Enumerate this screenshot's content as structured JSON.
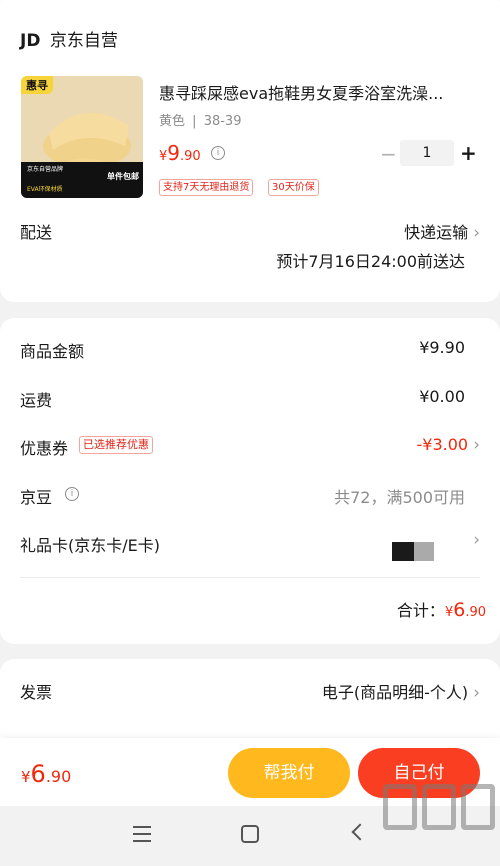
{
  "store": {
    "logo": "JD",
    "name": "京东自营"
  },
  "product": {
    "brand_badge": "惠寻",
    "title": "惠寻踩屎感eva拖鞋男女夏季浴室洗澡...",
    "spec_color": "黄色",
    "spec_divider": "|",
    "spec_size": "38-39",
    "price_symbol": "¥",
    "price_int": "9",
    "price_dec": ".90",
    "tags": [
      "支持7天无理由退货",
      "30天价保"
    ],
    "thumb_text": [
      "京东自营品牌",
      "单件包邮",
      "EVA环保材质"
    ],
    "thumb_colors": {
      "background": "#ead9b2",
      "slipper": "#f0d28a",
      "badge": "#f7d43a",
      "strip": "#111111"
    }
  },
  "stepper": {
    "minus": "−",
    "quantity": "1",
    "plus": "+"
  },
  "delivery": {
    "label": "配送",
    "method": "快递运输",
    "estimate": "预计7月16日24:00前送达"
  },
  "summary": {
    "goods_label": "商品金额",
    "goods_value": "¥9.90",
    "shipping_label": "运费",
    "shipping_value": "¥0.00",
    "coupon_label": "优惠券",
    "coupon_tag": "已选推荐优惠",
    "coupon_value": "-¥3.00",
    "beans_label": "京豆",
    "beans_value": "共72，满500可用",
    "giftcard_label": "礼品卡(京东卡/E卡)",
    "total_label": "合计：",
    "total_symbol": "¥",
    "total_int": "6",
    "total_dec": ".90"
  },
  "invoice": {
    "label": "发票",
    "value": "电子(商品明细-个人)"
  },
  "bottom_bar": {
    "price_symbol": "¥",
    "price_int": "6",
    "price_dec": ".90",
    "help_pay": "帮我付",
    "self_pay": "自己付"
  },
  "colors": {
    "accent": "#f2270c",
    "help_pay_bg": "#ffb81e",
    "self_pay_bg": "#f93e22",
    "page_bg": "#f2f2f2"
  }
}
